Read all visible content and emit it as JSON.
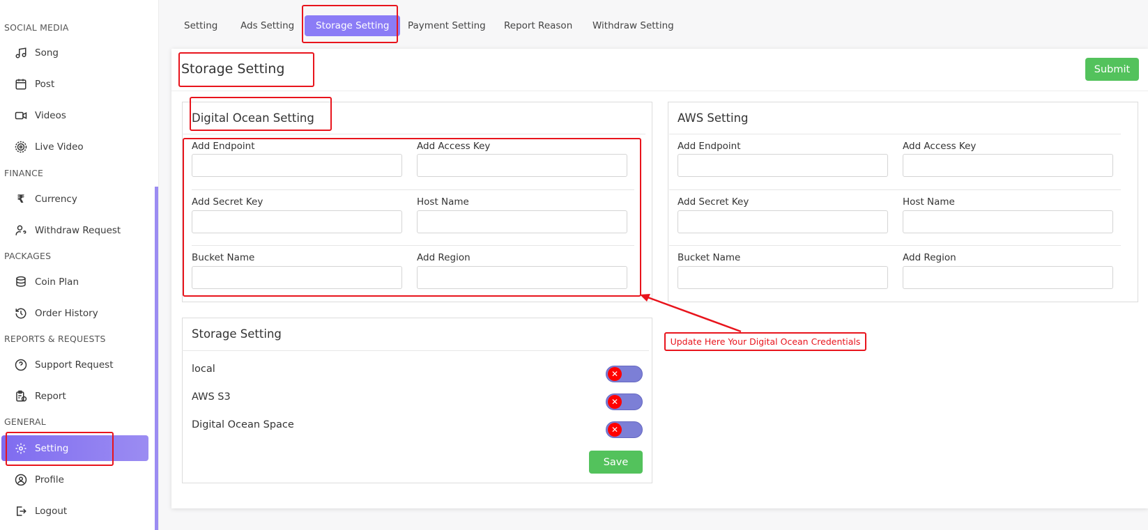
{
  "sidebar": {
    "sections": {
      "social_media": "SOCIAL MEDIA",
      "finance": "FINANCE",
      "packages": "PACKAGES",
      "reports": "REPORTS & REQUESTS",
      "general": "GENERAL"
    },
    "items": {
      "song": "Song",
      "post": "Post",
      "videos": "Videos",
      "live_video": "Live Video",
      "currency": "Currency",
      "withdraw_request": "Withdraw Request",
      "coin_plan": "Coin Plan",
      "order_history": "Order History",
      "support_request": "Support Request",
      "report": "Report",
      "setting": "Setting",
      "profile": "Profile",
      "logout": "Logout"
    }
  },
  "tabs": [
    "Setting",
    "Ads Setting",
    "Storage Setting",
    "Payment Setting",
    "Report Reason",
    "Withdraw Setting"
  ],
  "active_tab": "Storage Setting",
  "page": {
    "title": "Storage Setting",
    "submit_label": "Submit"
  },
  "digital_ocean": {
    "title": "Digital Ocean Setting",
    "labels": {
      "endpoint": "Add Endpoint",
      "access_key": "Add Access Key",
      "secret_key": "Add Secret Key",
      "host_name": "Host Name",
      "bucket_name": "Bucket Name",
      "region": "Add Region"
    },
    "values": {
      "endpoint": "",
      "access_key": "",
      "secret_key": "",
      "host_name": "",
      "bucket_name": "",
      "region": ""
    }
  },
  "aws": {
    "title": "AWS Setting",
    "labels": {
      "endpoint": "Add Endpoint",
      "access_key": "Add Access Key",
      "secret_key": "Add Secret Key",
      "host_name": "Host Name",
      "bucket_name": "Bucket Name",
      "region": "Add Region"
    },
    "values": {
      "endpoint": "",
      "access_key": "",
      "secret_key": "",
      "host_name": "",
      "bucket_name": "",
      "region": ""
    }
  },
  "storage": {
    "title": "Storage Setting",
    "options": [
      {
        "label": "local",
        "enabled": false,
        "knob": "✕"
      },
      {
        "label": "AWS S3",
        "enabled": false,
        "knob": "✕"
      },
      {
        "label": "Digital Ocean Space",
        "enabled": false,
        "knob": "✕"
      }
    ],
    "save_label": "Save"
  },
  "annotation": {
    "callout": "Update Here Your Digital Ocean Credentials",
    "color": "#e8141c"
  },
  "colors": {
    "accent": "#8b7cf6",
    "success": "#53c25c",
    "toggle_off": "#7c7fd6",
    "toggle_knob": "#ff0000"
  }
}
